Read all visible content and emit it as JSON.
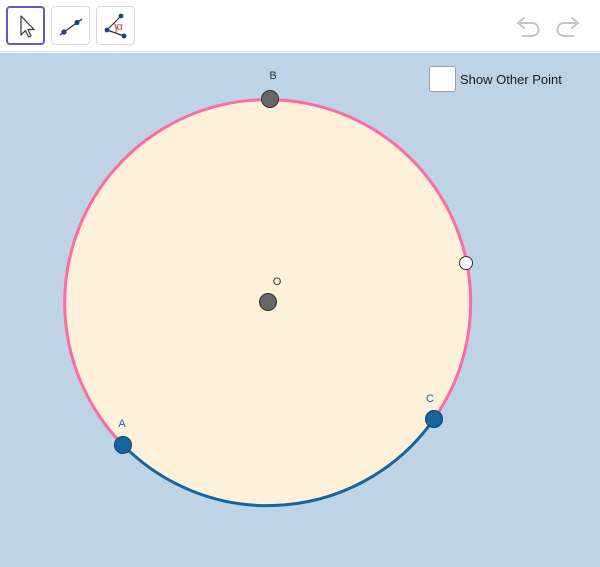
{
  "toolbar": {
    "tools": [
      {
        "name": "move",
        "active": true
      },
      {
        "name": "segment",
        "active": false
      },
      {
        "name": "angle",
        "active": false
      }
    ],
    "undo_icon": "undo-icon",
    "redo_icon": "redo-icon"
  },
  "checkbox": {
    "label": "Show Other Point",
    "checked": false
  },
  "points": {
    "A": {
      "label": "A",
      "color": "#1565a0"
    },
    "B": {
      "label": "B",
      "color": "#616161"
    },
    "C": {
      "label": "C",
      "color": "#1565a0"
    },
    "O": {
      "label": "O",
      "color": "#616161"
    }
  },
  "colors": {
    "background": "#bed4e6",
    "circle_fill": "#fff0da",
    "major_arc": "#ff6b9e",
    "minor_arc": "#1565a0",
    "toolbar_active": "#6557d2"
  }
}
